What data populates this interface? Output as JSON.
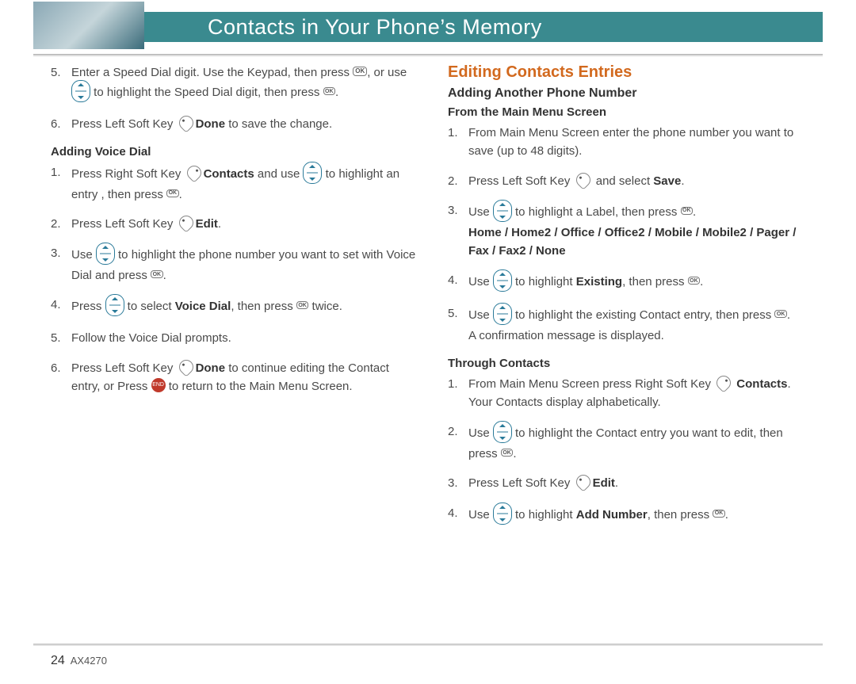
{
  "header": {
    "title": "Contacts in Your Phone’s Memory"
  },
  "left": {
    "steps_top": [
      {
        "pre": "Enter a Speed Dial digit. Use the Keypad, then press ",
        "icon1": "ok",
        "mid": ", or use ",
        "icon2": "nav",
        "mid2": " to highlight the Speed Dial digit, then press ",
        "icon3": "ok-sm",
        "post": "."
      },
      {
        "pre": "Press Left Soft Key ",
        "icon1": "softL",
        "mid": " ",
        "bold": "Done",
        "post": " to save the change."
      }
    ],
    "h_voice": "Adding Voice Dial",
    "voice_steps": [
      {
        "pre": "Press Right Soft Key ",
        "icon1": "softR",
        "mid": " ",
        "bold": "Contacts",
        "mid2": " and use ",
        "icon2": "nav",
        "mid3": " to highlight an entry , then press ",
        "icon3": "ok-sm",
        "post": "."
      },
      {
        "pre": "Press Left Soft Key ",
        "icon1": "softL",
        "mid": " ",
        "bold": "Edit",
        "post": "."
      },
      {
        "pre": "Use ",
        "icon1": "nav",
        "mid": " to highlight the phone number you want to set with Voice Dial and press ",
        "icon2": "ok-sm",
        "post": "."
      },
      {
        "pre": "Press ",
        "icon1": "nav",
        "mid": " to select ",
        "bold": "Voice Dial",
        "mid2": ", then press ",
        "icon2": "ok-sm",
        "post": " twice."
      },
      {
        "pre": "Follow the Voice Dial prompts."
      },
      {
        "pre": "Press Left Soft Key ",
        "icon1": "softL",
        "mid": " ",
        "bold": "Done",
        "mid2": " to continue editing the Contact entry, or Press ",
        "icon2": "end",
        "mid3": " to return to the Main Menu Screen."
      }
    ]
  },
  "right": {
    "h_edit": "Editing Contacts Entries",
    "h_another": "Adding Another Phone Number",
    "h_from": "From the Main Menu Screen",
    "from_steps": [
      {
        "pre": "From Main Menu Screen enter the phone number you want to save (up to 48 digits)."
      },
      {
        "pre": "Press Left Soft Key ",
        "icon1": "softL",
        "mid": " and select ",
        "bold": "Save",
        "post": "."
      },
      {
        "pre": "Use ",
        "icon1": "nav",
        "mid": " to highlight a Label, then press ",
        "icon2": "ok-sm",
        "post": ".",
        "extra_bold": "Home / Home2 / Office / Office2 / Mobile / Mobile2 / Pager / Fax / Fax2 / None"
      },
      {
        "pre": "Use ",
        "icon1": "nav",
        "mid": " to highlight ",
        "bold": "Existing",
        "mid2": ", then press ",
        "icon2": "ok-sm",
        "post": "."
      },
      {
        "pre": "Use ",
        "icon1": "nav",
        "mid": " to highlight the existing Contact entry, then press ",
        "icon2": "ok-sm",
        "post": ".",
        "extra": "A confirmation message is displayed."
      }
    ],
    "h_through": "Through Contacts",
    "through_steps": [
      {
        "pre": "From Main Menu Screen press Right Soft Key ",
        "icon1": "softR",
        "post_bold": "Contacts",
        "mid": ". Your Contacts display alphabetically."
      },
      {
        "pre": "Use ",
        "icon1": "nav",
        "mid": " to highlight the Contact entry you want to edit, then press ",
        "icon2": "ok-sm",
        "post": "."
      },
      {
        "pre": "Press Left Soft Key ",
        "icon1": "softL",
        "mid": " ",
        "bold": "Edit",
        "post": "."
      },
      {
        "pre": "Use ",
        "icon1": "nav",
        "mid": " to highlight ",
        "bold": "Add Number",
        "mid2": ", then press ",
        "icon2": "ok-sm",
        "post": "."
      }
    ]
  },
  "footer": {
    "page": "24",
    "model": "AX4270"
  }
}
